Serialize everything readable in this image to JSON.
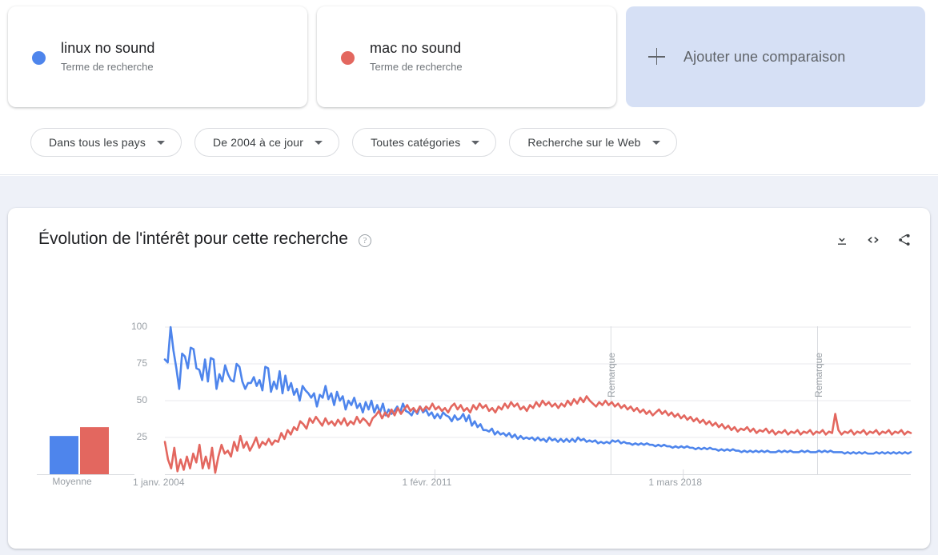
{
  "search_terms": [
    {
      "label": "linux no sound",
      "type_label": "Terme de recherche",
      "color": "#4e85ec",
      "dot_name": "series-dot-blue"
    },
    {
      "label": "mac no sound",
      "type_label": "Terme de recherche",
      "color": "#e3675f",
      "dot_name": "series-dot-red"
    }
  ],
  "add_comparison": {
    "label": "Ajouter une comparaison",
    "icon": "plus-icon"
  },
  "filters": [
    {
      "label": "Dans tous les pays",
      "name": "filter-location"
    },
    {
      "label": "De 2004 à ce jour",
      "name": "filter-time-range"
    },
    {
      "label": "Toutes catégories",
      "name": "filter-category"
    },
    {
      "label": "Recherche sur le Web",
      "name": "filter-search-type"
    }
  ],
  "chart_card": {
    "title": "Évolution de l'intérêt pour cette recherche",
    "help_icon": "help-circle-icon",
    "help_glyph": "?",
    "actions": [
      {
        "name": "download-csv-button",
        "icon": "download-icon"
      },
      {
        "name": "embed-code-button",
        "icon": "embed-code-icon"
      },
      {
        "name": "share-button",
        "icon": "share-icon"
      }
    ]
  },
  "chart_data": {
    "type": "line",
    "title": "Évolution de l'intérêt pour cette recherche",
    "xlabel": "",
    "ylabel": "",
    "ylim": [
      0,
      100
    ],
    "yticks": [
      25,
      50,
      75,
      100
    ],
    "grid": true,
    "legend_position": "top-cards",
    "x_tick_labels": [
      "1 janv. 2004",
      "1 févr. 2011",
      "1 mars 2018"
    ],
    "x_tick_positions_frac": [
      0.0,
      0.362,
      0.695
    ],
    "annotations": [
      {
        "label": "Remarque",
        "x_frac": 0.598,
        "orientation": "vertical"
      },
      {
        "label": "Remarque",
        "x_frac": 0.875,
        "orientation": "vertical"
      }
    ],
    "average_panel": {
      "label": "Moyenne",
      "bars": [
        {
          "name": "linux no sound",
          "value": 26,
          "color": "#4e85ec"
        },
        {
          "name": "mac no sound",
          "value": 32,
          "color": "#e3675f"
        }
      ]
    },
    "series": [
      {
        "name": "linux no sound",
        "color": "#4e85ec",
        "values": [
          78,
          76,
          100,
          84,
          72,
          58,
          82,
          80,
          72,
          86,
          85,
          72,
          71,
          64,
          78,
          63,
          79,
          78,
          58,
          68,
          63,
          74,
          68,
          64,
          63,
          75,
          73,
          63,
          58,
          62,
          62,
          66,
          60,
          64,
          57,
          73,
          72,
          56,
          63,
          58,
          70,
          55,
          67,
          57,
          62,
          54,
          58,
          50,
          60,
          57,
          55,
          52,
          55,
          46,
          54,
          52,
          60,
          51,
          55,
          47,
          56,
          50,
          53,
          44,
          50,
          47,
          52,
          45,
          48,
          42,
          49,
          44,
          50,
          42,
          47,
          42,
          48,
          40,
          44,
          41,
          43,
          46,
          42,
          48,
          43,
          42,
          40,
          44,
          41,
          46,
          42,
          44,
          40,
          42,
          38,
          41,
          38,
          42,
          40,
          39,
          36,
          40,
          37,
          38,
          41,
          36,
          40,
          33,
          36,
          32,
          34,
          30,
          30,
          29,
          31,
          27,
          29,
          27,
          28,
          26,
          28,
          25,
          27,
          24,
          26,
          24,
          25,
          24,
          25,
          23,
          25,
          23,
          24,
          22,
          25,
          23,
          24,
          22,
          24,
          22,
          24,
          22,
          24,
          22,
          25,
          23,
          24,
          22,
          23,
          22,
          23,
          21,
          22,
          21,
          22,
          21,
          23,
          22,
          23,
          21,
          22,
          21,
          21,
          20,
          21,
          20,
          21,
          20,
          21,
          20,
          20,
          19,
          20,
          19,
          20,
          19,
          19,
          18,
          19,
          18,
          19,
          18,
          19,
          18,
          18,
          17,
          18,
          17,
          18,
          17,
          18,
          17,
          17,
          16,
          17,
          16,
          17,
          16,
          17,
          16,
          16,
          15,
          16,
          15,
          16,
          15,
          16,
          15,
          16,
          15,
          16,
          15,
          15,
          15,
          16,
          15,
          16,
          15,
          16,
          15,
          15,
          15,
          16,
          15,
          16,
          15,
          15,
          15,
          16,
          15,
          16,
          15,
          16,
          15,
          15,
          15,
          15,
          14,
          15,
          14,
          15,
          14,
          15,
          14,
          15,
          14,
          14,
          14,
          15,
          14,
          15,
          14,
          15,
          14,
          15,
          14,
          15,
          14,
          15,
          14,
          15
        ]
      },
      {
        "name": "mac no sound",
        "color": "#e3675f",
        "values": [
          22,
          10,
          4,
          18,
          2,
          10,
          3,
          12,
          4,
          14,
          8,
          20,
          4,
          12,
          4,
          18,
          1,
          12,
          20,
          14,
          16,
          12,
          22,
          16,
          26,
          18,
          22,
          16,
          20,
          25,
          18,
          22,
          20,
          24,
          20,
          23,
          22,
          28,
          24,
          30,
          27,
          32,
          30,
          36,
          34,
          31,
          38,
          35,
          39,
          36,
          33,
          38,
          34,
          36,
          33,
          37,
          34,
          38,
          33,
          36,
          34,
          39,
          35,
          38,
          36,
          33,
          38,
          40,
          43,
          38,
          42,
          39,
          44,
          40,
          45,
          41,
          44,
          47,
          43,
          45,
          42,
          46,
          43,
          46,
          44,
          48,
          44,
          46,
          43,
          45,
          42,
          46,
          48,
          44,
          47,
          43,
          45,
          42,
          47,
          44,
          48,
          45,
          47,
          43,
          45,
          42,
          46,
          44,
          48,
          45,
          49,
          46,
          48,
          44,
          46,
          43,
          47,
          45,
          49,
          46,
          50,
          47,
          49,
          46,
          48,
          45,
          48,
          46,
          50,
          47,
          51,
          48,
          52,
          49,
          53,
          50,
          48,
          46,
          49,
          47,
          50,
          47,
          49,
          46,
          48,
          45,
          47,
          44,
          46,
          43,
          45,
          42,
          44,
          41,
          43,
          40,
          42,
          44,
          41,
          43,
          40,
          42,
          39,
          41,
          38,
          40,
          37,
          39,
          36,
          38,
          35,
          37,
          34,
          36,
          33,
          35,
          32,
          34,
          31,
          33,
          30,
          32,
          29,
          31,
          30,
          32,
          29,
          31,
          28,
          30,
          29,
          31,
          28,
          30,
          27,
          29,
          28,
          30,
          27,
          29,
          28,
          30,
          27,
          29,
          28,
          30,
          27,
          29,
          28,
          30,
          27,
          29,
          28,
          41,
          30,
          27,
          29,
          28,
          30,
          27,
          29,
          28,
          30,
          27,
          29,
          28,
          30,
          27,
          29,
          28,
          30,
          27,
          29,
          28,
          30,
          27,
          29,
          28
        ]
      }
    ]
  }
}
